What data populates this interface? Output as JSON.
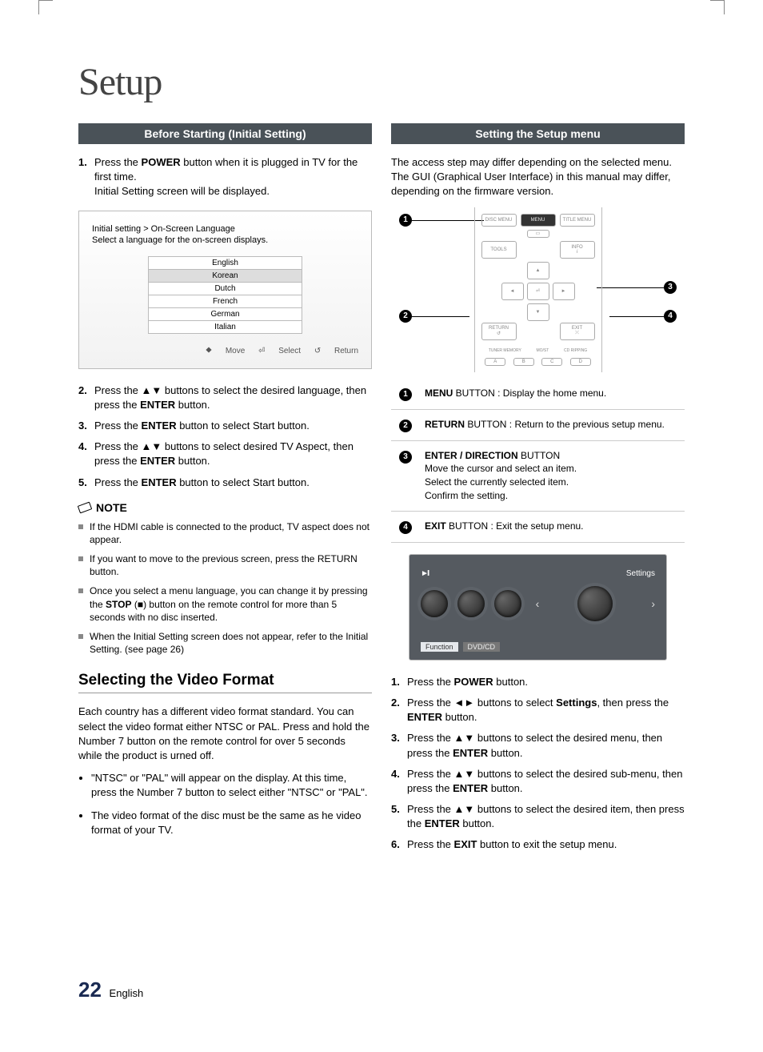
{
  "page_title": "Setup",
  "left": {
    "section_bar": "Before Starting (Initial Setting)",
    "steps1": [
      {
        "num": "1.",
        "html": "Press the <b>POWER</b> button when it is plugged in TV for the first time.<br>Initial Setting screen will be displayed."
      }
    ],
    "panel": {
      "breadcrumb": "Initial setting > On-Screen Language",
      "instruction": "Select a language for the on-screen displays.",
      "languages": [
        "English",
        "Korean",
        "Dutch",
        "French",
        "German",
        "Italian"
      ],
      "selected_index": 1,
      "footer": {
        "move": "Move",
        "select": "Select",
        "return": "Return"
      }
    },
    "steps2": [
      {
        "num": "2.",
        "html": "Press the ▲▼ buttons to select the desired language, then press the <b>ENTER</b> button."
      },
      {
        "num": "3.",
        "html": "Press the <b>ENTER</b> button to select Start button."
      },
      {
        "num": "4.",
        "html": "Press the ▲▼ buttons to select desired TV Aspect, then press the <b>ENTER</b> button."
      },
      {
        "num": "5.",
        "html": "Press the <b>ENTER</b> button to select Start button."
      }
    ],
    "note_label": "NOTE",
    "notes": [
      "If the HDMI cable is connected to the product, TV aspect does not appear.",
      "If you want to move to the previous screen, press the RETURN button.",
      "Once you select a menu language, you can change it by pressing the <b>STOP</b> (■) button on the remote control for more than 5 seconds with no disc inserted.",
      "When the Initial Setting screen does not appear, refer to the Initial Setting. (see page 26)"
    ],
    "sub_heading": "Selecting the Video Format",
    "video_intro": "Each country has a different video format standard. You can select the video format either NTSC or PAL. Press and hold the Number 7 button on the remote control for over 5 seconds while the product is urned off.",
    "video_bullets": [
      "\"NTSC\" or \"PAL\" will appear on the display. At this time, press the Number 7 button to select either \"NTSC\" or \"PAL\".",
      "The video format of the disc must be the same as he video format of your TV."
    ]
  },
  "right": {
    "section_bar": "Setting the Setup menu",
    "intro": "The access step may differ depending on the selected menu. The GUI (Graphical User Interface) in this manual may differ, depending on the firmware version.",
    "remote": {
      "disc_menu": "DISC MENU",
      "menu": "MENU",
      "title_menu": "TITLE MENU",
      "tools": "TOOLS",
      "info": "INFO",
      "return": "RETURN",
      "exit": "EXIT",
      "bottom": [
        "TUNER MEMORY",
        "MO/ST",
        "CD RIPPING"
      ],
      "bottom2": [
        "A",
        "B",
        "C",
        "D"
      ]
    },
    "callouts": {
      "c1": "1",
      "c2": "2",
      "c3": "3",
      "c4": "4"
    },
    "defs": [
      {
        "n": "1",
        "html": "<b>MENU</b> BUTTON : Display the home menu."
      },
      {
        "n": "2",
        "html": "<b>RETURN</b> BUTTON : Return to the previous setup menu."
      },
      {
        "n": "3",
        "html": "<b>ENTER / DIRECTION</b> BUTTON<br>Move the cursor and select an item.<br>Select the currently selected item.<br>Confirm the setting."
      },
      {
        "n": "4",
        "html": "<b>EXIT</b> BUTTON : Exit the setup menu."
      }
    ],
    "tv": {
      "settings_label": "Settings",
      "function_label": "Function",
      "source_label": "DVD/CD"
    },
    "steps": [
      {
        "num": "1.",
        "html": "Press the <b>POWER</b> button."
      },
      {
        "num": "2.",
        "html": "Press the ◄► buttons to select <b>Settings</b>, then press the <b>ENTER</b> button."
      },
      {
        "num": "3.",
        "html": "Press the ▲▼ buttons to select the desired menu, then press the <b>ENTER</b> button."
      },
      {
        "num": "4.",
        "html": "Press the ▲▼ buttons to select the desired sub-menu, then press the <b>ENTER</b> button."
      },
      {
        "num": "5.",
        "html": "Press the ▲▼ buttons to select the desired item, then press the <b>ENTER</b> button."
      },
      {
        "num": "6.",
        "html": "Press the <b>EXIT</b> button to exit the setup menu."
      }
    ]
  },
  "footer": {
    "page_num": "22",
    "lang": "English"
  }
}
